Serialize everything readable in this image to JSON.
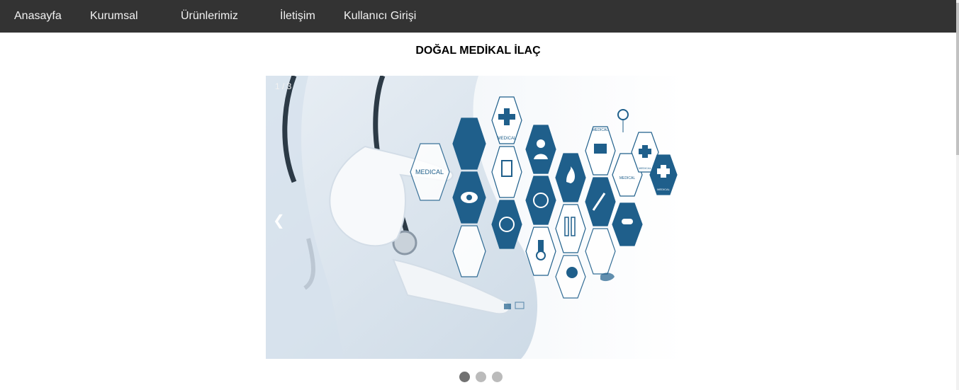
{
  "nav": {
    "items": [
      {
        "label": "Anasayfa"
      },
      {
        "label": "Kurumsal"
      },
      {
        "label": "Ürünlerimiz"
      },
      {
        "label": "İletişim"
      },
      {
        "label": "Kullanıcı Girişi"
      }
    ]
  },
  "page": {
    "title": "DOĞAL MEDİKAL İLAÇ"
  },
  "slideshow": {
    "number_text": "1 / 3",
    "prev_glyph": "❮",
    "hex_labels": {
      "medical_large": "MEDICAL",
      "medical_cross": "MEDICAL",
      "medical_kit": "MEDICAL",
      "medical_small_a": "MEDICAL",
      "medical_small_b": "MEDICAL",
      "medical_small_c": "MEDICAL"
    },
    "active_index": 1,
    "count": 3
  },
  "colors": {
    "nav_bg": "#333333",
    "nav_text": "#f2f2f2",
    "hex_blue": "#1f5f8b",
    "dot_active": "#717171",
    "dot_inactive": "#bbbbbb"
  }
}
